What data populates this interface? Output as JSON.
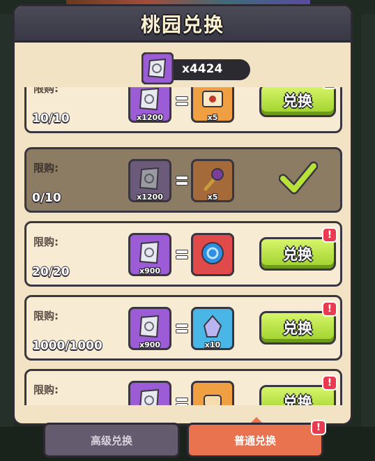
{
  "window": {
    "title": "桃园兑换"
  },
  "currency": {
    "amount": "x4424",
    "icon": "scroll-token-icon"
  },
  "limit_label": "限购:",
  "exchange_label": "兑换",
  "badge_text": "!",
  "rows": [
    {
      "limit": "10/10",
      "cost_qty": "x1200",
      "reward_qty": "x5",
      "reward_icon": "envelope-icon",
      "state": "available"
    },
    {
      "limit": "0/10",
      "cost_qty": "x1200",
      "reward_qty": "x5",
      "reward_icon": "flower-key-icon",
      "state": "completed"
    },
    {
      "limit": "20/20",
      "cost_qty": "x900",
      "reward_qty": "",
      "reward_icon": "blue-orb-icon",
      "state": "available"
    },
    {
      "limit": "1000/1000",
      "cost_qty": "x900",
      "reward_qty": "x10",
      "reward_icon": "crystal-icon",
      "state": "available"
    },
    {
      "limit": "",
      "cost_qty": "",
      "reward_qty": "",
      "reward_icon": "scroll-roll-icon",
      "state": "available"
    }
  ],
  "tabs": [
    {
      "label": "高级兑换",
      "active": false
    },
    {
      "label": "普通兑换",
      "active": true
    }
  ],
  "colors": {
    "panel": "#f2e3c4",
    "button_green": "#9ed12a",
    "badge_red": "#e93a50",
    "tab_active": "#e8734e",
    "tab_inactive": "#645c6e"
  }
}
